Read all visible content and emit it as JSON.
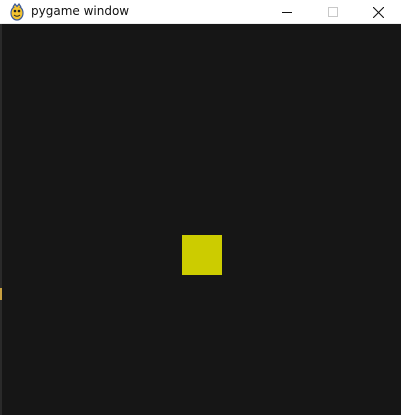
{
  "window": {
    "title": "pygame window",
    "icon": "pygame-snake-icon",
    "controls": {
      "minimize_icon": "minimize-icon",
      "maximize_icon": "maximize-icon",
      "close_icon": "close-icon"
    }
  },
  "game": {
    "background_color": "#161616",
    "player_square_color": "#cccc00"
  }
}
